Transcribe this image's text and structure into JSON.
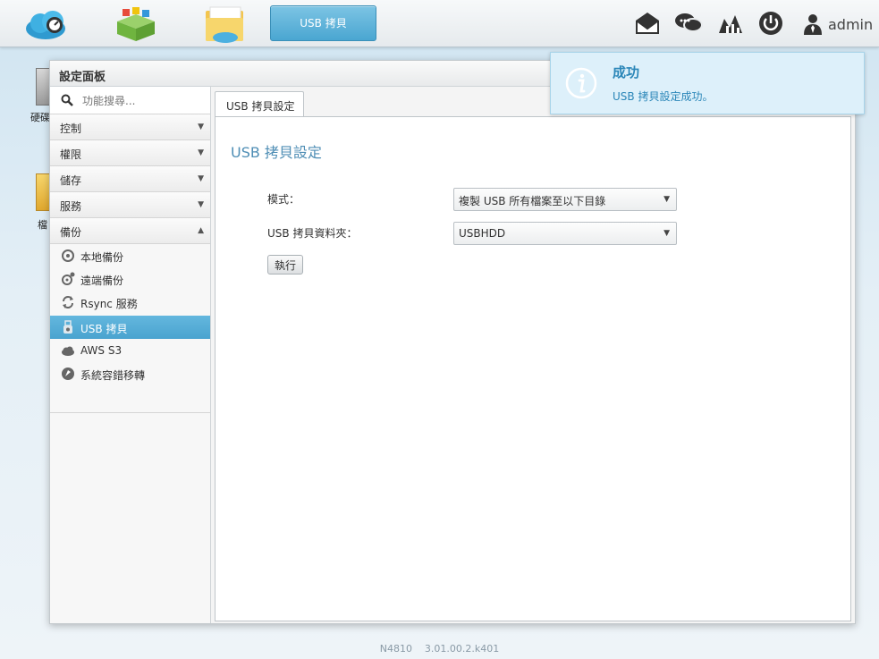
{
  "taskbar": {
    "apps": [
      {
        "icon": "cloud-dashboard-icon"
      },
      {
        "icon": "app-center-icon"
      },
      {
        "icon": "file-center-icon"
      }
    ],
    "active_task_label": "USB 拷貝",
    "tray": [
      "mail-icon",
      "chat-icon",
      "network-map-icon",
      "power-icon"
    ],
    "user_label": "admin"
  },
  "desktop": {
    "icons": [
      {
        "label": "硬碟",
        "icon": "hard-drive-icon"
      },
      {
        "label": "檔",
        "icon": "file-icon"
      }
    ]
  },
  "window": {
    "title": "設定面板",
    "search_placeholder": "功能搜尋...",
    "categories": [
      {
        "label": "控制",
        "expanded": false
      },
      {
        "label": "權限",
        "expanded": false
      },
      {
        "label": "儲存",
        "expanded": false
      },
      {
        "label": "服務",
        "expanded": false
      },
      {
        "label": "備份",
        "expanded": true
      }
    ],
    "backup_items": [
      {
        "label": "本地備份",
        "icon": "local-backup-icon",
        "active": false
      },
      {
        "label": "遠端備份",
        "icon": "remote-backup-icon",
        "active": false
      },
      {
        "label": "Rsync 服務",
        "icon": "sync-icon",
        "active": false
      },
      {
        "label": "USB 拷貝",
        "icon": "usb-icon",
        "active": true
      },
      {
        "label": "AWS S3",
        "icon": "cloud-icon",
        "active": false
      },
      {
        "label": "系統容錯移轉",
        "icon": "failover-icon",
        "active": false
      }
    ],
    "tab_label": "USB 拷貝設定",
    "content_title": "USB 拷貝設定",
    "form": {
      "mode_label": "模式：",
      "mode_value": "複製 USB 所有檔案至以下目錄",
      "folder_label": "USB 拷貝資料夾：",
      "folder_value": "USBHDD",
      "run_label": "執行"
    }
  },
  "toast": {
    "title": "成功",
    "message": "USB 拷貝設定成功。",
    "icon": "info-icon"
  },
  "footer": "N4810    3.01.00.2.k401",
  "colors": {
    "accent": "#4aa6d1",
    "toast_bg": "#ddf0fa",
    "toast_text": "#2a86b8",
    "title_blue": "#4f8eb5"
  }
}
